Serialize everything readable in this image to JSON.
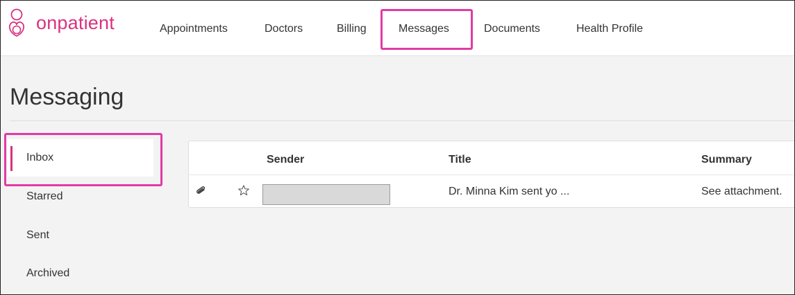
{
  "brand": {
    "name": "onpatient",
    "color": "#d9327f"
  },
  "nav": {
    "items": [
      {
        "label": "Appointments"
      },
      {
        "label": "Doctors"
      },
      {
        "label": "Billing"
      },
      {
        "label": "Messages",
        "active": true
      },
      {
        "label": "Documents"
      },
      {
        "label": "Health Profile"
      }
    ]
  },
  "page": {
    "title": "Messaging"
  },
  "sidebar": {
    "items": [
      {
        "label": "Inbox",
        "active": true
      },
      {
        "label": "Starred"
      },
      {
        "label": "Sent"
      },
      {
        "label": "Archived"
      }
    ]
  },
  "table": {
    "headers": {
      "sender": "Sender",
      "title": "Title",
      "summary": "Summary"
    },
    "rows": [
      {
        "attachment_icon": "paperclip-icon",
        "star_icon": "star-outline-icon",
        "sender": "",
        "title": "Dr. Minna Kim sent yo ...",
        "summary": "See attachment."
      }
    ]
  },
  "annotation_color": "#e23aa5"
}
